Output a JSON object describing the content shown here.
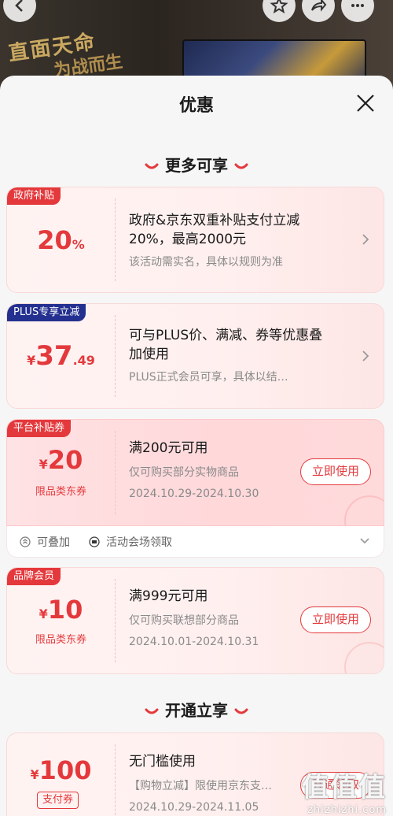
{
  "background": {
    "calligraphy_line1": "直面天命",
    "calligraphy_line2": "为战而生"
  },
  "sheet": {
    "title": "优惠"
  },
  "sections": {
    "more": "更多可享",
    "open": "开通立享"
  },
  "cards": {
    "gov": {
      "tag": "政府补贴",
      "amount": "20",
      "unit": "%",
      "main": "政府&京东双重补贴支付立减20%，最高2000元",
      "sub": "该活动需实名，具体以规则为准"
    },
    "plus": {
      "tag": "PLUS专享立减",
      "currency": "¥",
      "amount": "37",
      "decimal": ".49",
      "main": "可与PLUS价、满减、券等优惠叠加使用",
      "sub": "PLUS正式会员可享，具体以结…"
    },
    "platform": {
      "tag": "平台补贴券",
      "currency": "¥",
      "amount": "20",
      "sub_label": "限品类东券",
      "main": "满200元可用",
      "desc": "仅可购买部分实物商品",
      "date": "2024.10.29-2024.10.30",
      "button": "立即使用"
    },
    "brand": {
      "tag": "品牌会员",
      "currency": "¥",
      "amount": "10",
      "sub_label": "限品类东券",
      "main": "满999元可用",
      "desc": "仅可购买联想部分商品",
      "date": "2024.10.01-2024.10.31",
      "button": "立即使用"
    },
    "pay": {
      "currency": "¥",
      "amount": "100",
      "sub_label": "支付券",
      "main": "无门槛使用",
      "desc": "【购物立减】限使用京东支…",
      "date": "2024.10.29-2024.11.05",
      "button": "开通领取"
    }
  },
  "stack_row": {
    "stackable": "可叠加",
    "venue": "活动会场领取"
  },
  "watermark": {
    "big": "值值值",
    "small": "zhizhizhi.com"
  },
  "colors": {
    "accent": "#e4393c",
    "plus_tag": "#24308f"
  }
}
